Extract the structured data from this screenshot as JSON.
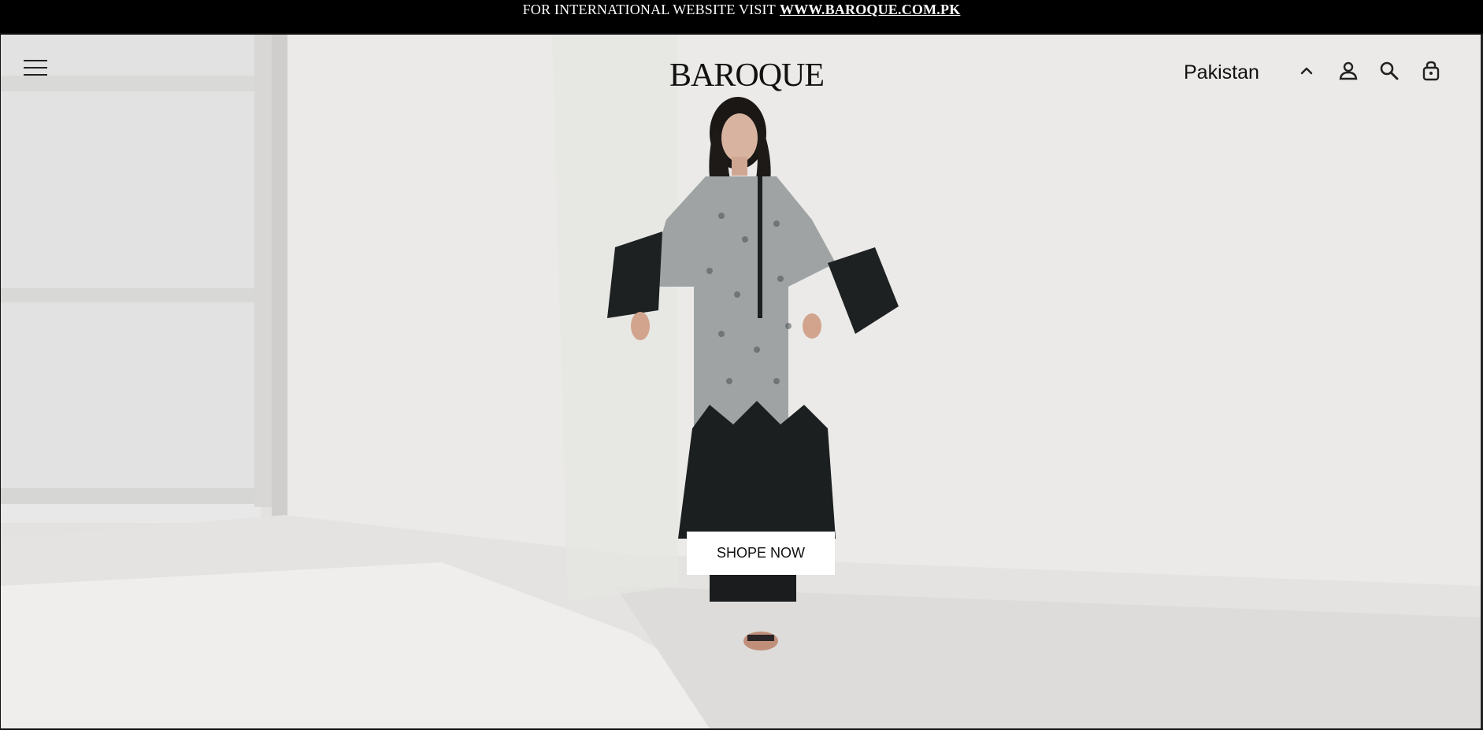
{
  "announcement": {
    "text": "FOR INTERNATIONAL WEBSITE VISIT",
    "link": "WWW.BAROQUE.COM.PK"
  },
  "header": {
    "logo": "BAROQUE",
    "country": "Pakistan",
    "icons": [
      "menu-icon",
      "chevron-up-icon",
      "user-icon",
      "search-icon",
      "bag-icon"
    ]
  },
  "hero": {
    "cta_label": "SHOPE NOW"
  },
  "colors": {
    "announcement_bg": "#000000",
    "text": "#111111",
    "logo_accent": "#d42a2a",
    "background": "#ecebea",
    "button_bg": "#ffffff"
  }
}
